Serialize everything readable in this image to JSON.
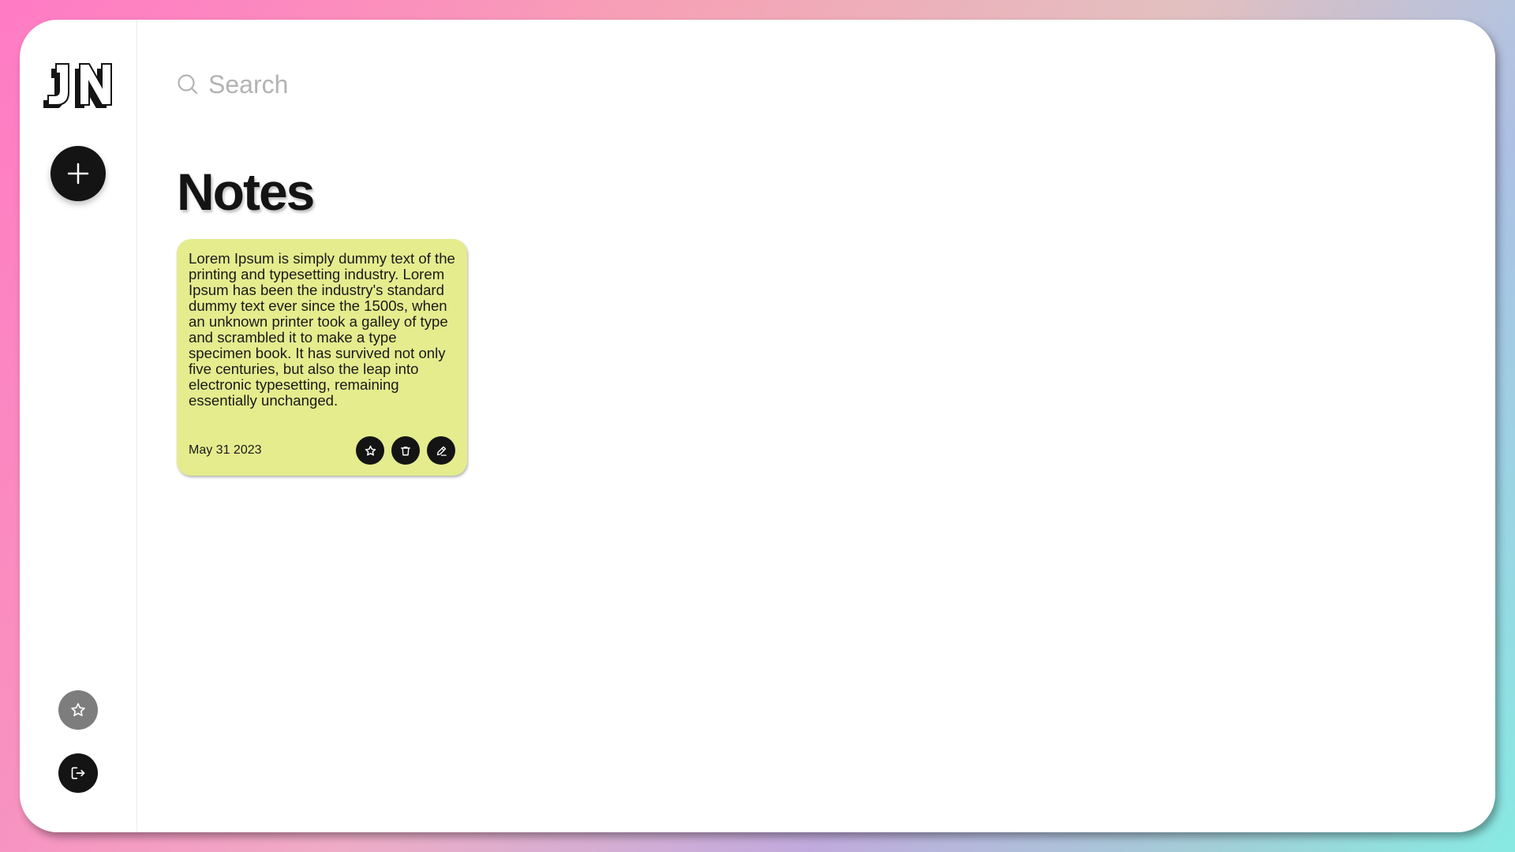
{
  "app": {
    "logo_text": "JN"
  },
  "sidebar": {
    "add_icon": "plus-icon",
    "favorites_icon": "star-icon",
    "logout_icon": "logout-icon"
  },
  "search": {
    "placeholder": "Search",
    "value": "",
    "icon": "search-icon"
  },
  "main": {
    "title": "Notes"
  },
  "notes": [
    {
      "text": "Lorem Ipsum is simply dummy text of the printing and typesetting industry. Lorem Ipsum has been the industry's standard dummy text ever since the 1500s, when an unknown printer took a galley of type and scrambled it to make a type specimen book. It has survived not only five centuries, but also the leap into electronic typesetting, remaining essentially unchanged.",
      "date": "May 31 2023",
      "color": "#e4ec8e",
      "actions": [
        "star-icon",
        "trash-icon",
        "pencil-icon"
      ]
    }
  ],
  "colors": {
    "accent": "#141414",
    "favorites_button": "#7d7d7d",
    "note_card": "#e4ec8e",
    "surface": "#ffffff"
  }
}
